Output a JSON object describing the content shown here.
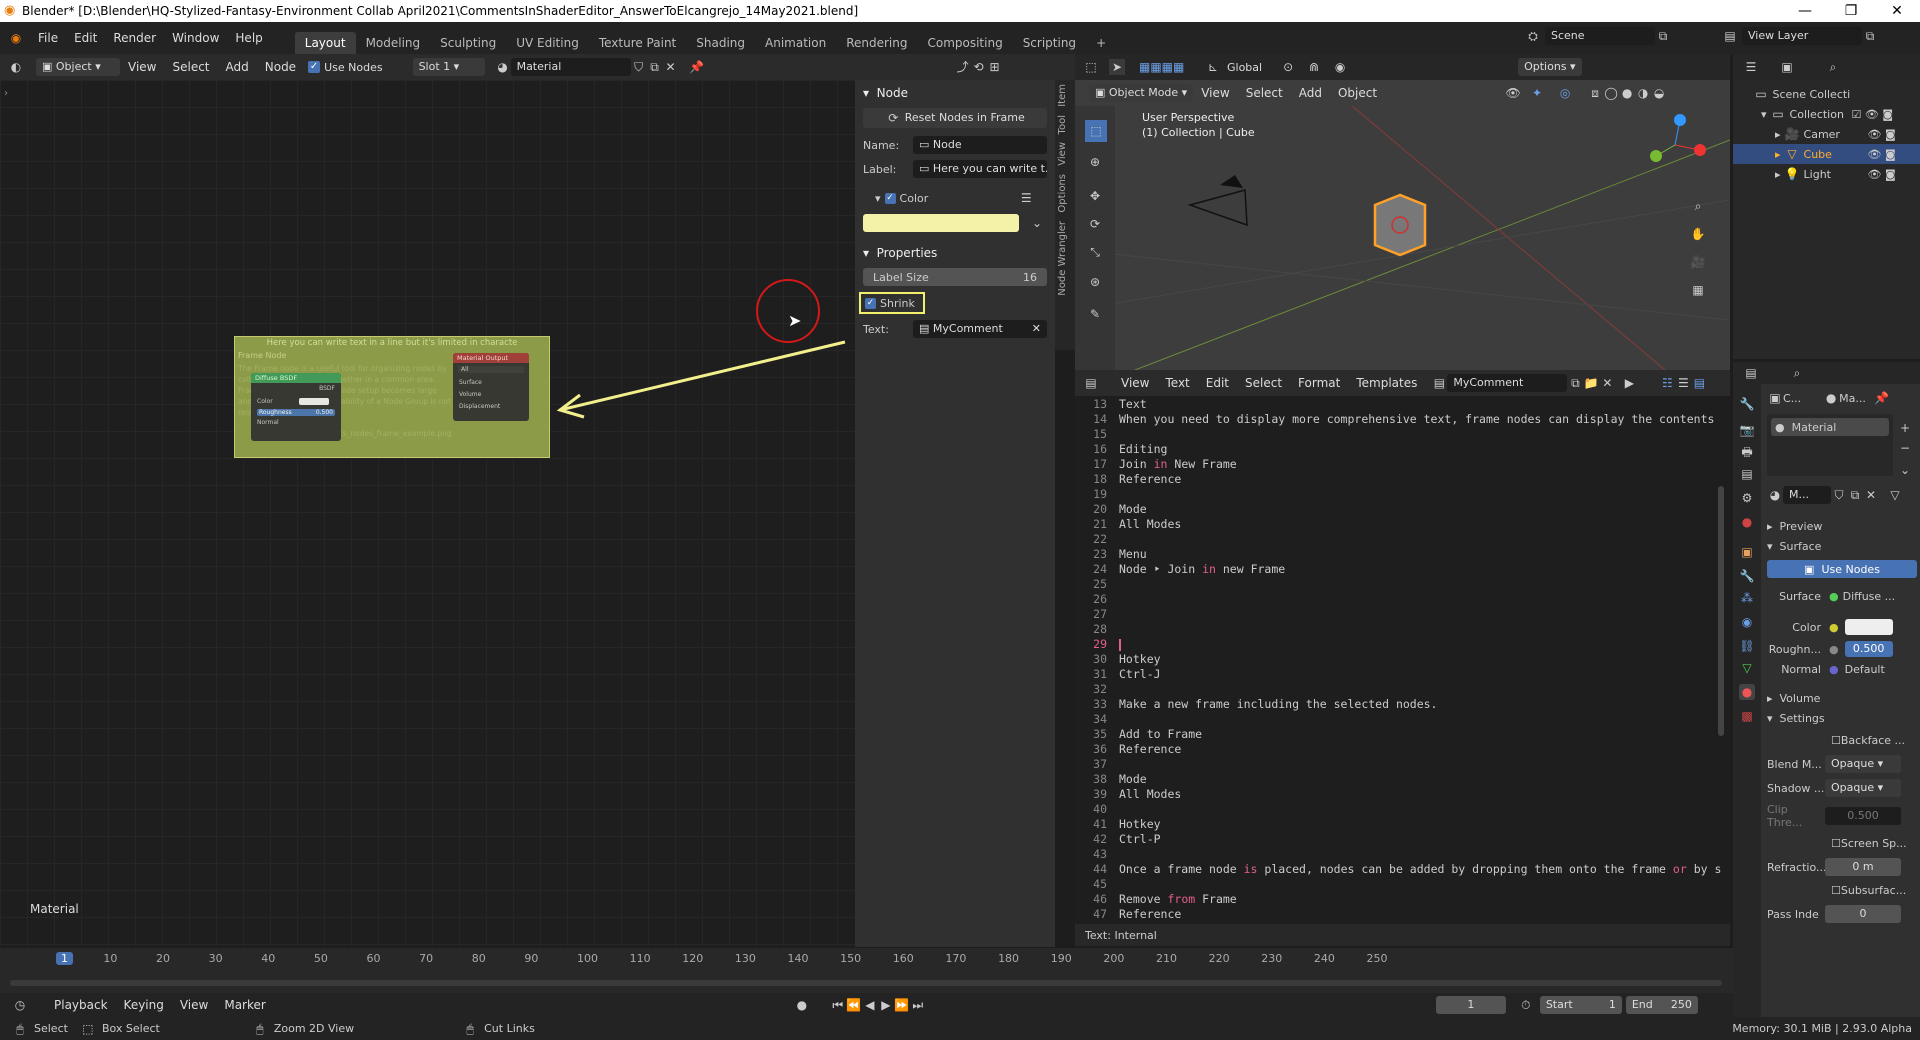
{
  "title": "Blender* [D:\\Blender\\HQ-Stylized-Fantasy-Environment  Collab April2021\\CommentsInShaderEditor_AnswerToElcangrejo_14May2021.blend]",
  "menus": [
    "File",
    "Edit",
    "Render",
    "Window",
    "Help"
  ],
  "workspaces": [
    "Layout",
    "Modeling",
    "Sculpting",
    "UV Editing",
    "Texture Paint",
    "Shading",
    "Animation",
    "Rendering",
    "Compositing",
    "Scripting"
  ],
  "scene_label": "Scene",
  "view_layer_label": "View Layer",
  "node_header": {
    "object": "Object",
    "menus": [
      "View",
      "Select",
      "Add",
      "Node"
    ],
    "use_nodes": "Use Nodes",
    "slot": "Slot 1",
    "material": "Material"
  },
  "node_editor": {
    "material_label": "Material",
    "frame": {
      "label": "Here you can write text in a line but it's limited in characte",
      "title": "Frame Node",
      "body": "The Frame node is a useful tool for organizing nodes by collecting related nodes together in a common area. Frames are useful when a node setup becomes large and confusing yet the re-usability of a Node Group is not required.",
      "footer": "nts_nodes_frame_example.png",
      "diffuse": "Diffuse BSDF",
      "bsdf": "BSDF",
      "color": "Color",
      "roughness": "Roughness",
      "roughness_val": "0.500",
      "normal": "Normal",
      "output": "Material Output",
      "output_target": "All",
      "surface": "Surface",
      "volume": "Volume",
      "displacement": "Displacement"
    }
  },
  "npanel": {
    "node_section": "Node",
    "reset_btn": "Reset Nodes in Frame",
    "name_label": "Name:",
    "name_value": "Node",
    "label_label": "Label:",
    "label_value": "Here you can write t...",
    "color_section": "Color",
    "color_hex": "#f4f1a8",
    "properties_section": "Properties",
    "label_size_label": "Label Size",
    "label_size_value": "16",
    "shrink": "Shrink",
    "text_label": "Text:",
    "text_value": "MyComment",
    "tabs": [
      "Item",
      "Tool",
      "View",
      "Options",
      "Node Wrangler"
    ]
  },
  "viewport": {
    "mode": "Object Mode",
    "menus": [
      "View",
      "Select",
      "Add",
      "Object"
    ],
    "orientation": "Global",
    "options": "Options",
    "perspective": "User Perspective",
    "collection": "(1) Collection | Cube"
  },
  "text_editor": {
    "menus": [
      "View",
      "Text",
      "Edit",
      "Select",
      "Format",
      "Templates"
    ],
    "datablock": "MyComment",
    "footer": "Text: Internal",
    "lines": [
      {
        "n": "13",
        "t": "Text"
      },
      {
        "n": "14",
        "t": "When you need to display more comprehensive text, frame nodes can display the contents"
      },
      {
        "n": "15",
        "t": ""
      },
      {
        "n": "16",
        "t": "Editing"
      },
      {
        "n": "17",
        "t": "Join in New Frame"
      },
      {
        "n": "18",
        "t": "Reference"
      },
      {
        "n": "19",
        "t": ""
      },
      {
        "n": "20",
        "t": "Mode"
      },
      {
        "n": "21",
        "t": "All Modes"
      },
      {
        "n": "22",
        "t": ""
      },
      {
        "n": "23",
        "t": "Menu"
      },
      {
        "n": "24",
        "t": "Node ‣ Join in new Frame"
      },
      {
        "n": "25",
        "t": ""
      },
      {
        "n": "26",
        "t": ""
      },
      {
        "n": "27",
        "t": ""
      },
      {
        "n": "28",
        "t": ""
      },
      {
        "n": "29",
        "t": ""
      },
      {
        "n": "30",
        "t": "Hotkey"
      },
      {
        "n": "31",
        "t": "Ctrl-J"
      },
      {
        "n": "32",
        "t": ""
      },
      {
        "n": "33",
        "t": "Make a new frame including the selected nodes."
      },
      {
        "n": "34",
        "t": ""
      },
      {
        "n": "35",
        "t": "Add to Frame"
      },
      {
        "n": "36",
        "t": "Reference"
      },
      {
        "n": "37",
        "t": ""
      },
      {
        "n": "38",
        "t": "Mode"
      },
      {
        "n": "39",
        "t": "All Modes"
      },
      {
        "n": "40",
        "t": ""
      },
      {
        "n": "41",
        "t": "Hotkey"
      },
      {
        "n": "42",
        "t": "Ctrl-P"
      },
      {
        "n": "43",
        "t": ""
      },
      {
        "n": "44",
        "t": "Once a frame node is placed, nodes can be added by dropping them onto the frame or by s"
      },
      {
        "n": "45",
        "t": ""
      },
      {
        "n": "46",
        "t": "Remove from Frame"
      },
      {
        "n": "47",
        "t": "Reference"
      }
    ]
  },
  "outliner": {
    "scene_collection": "Scene Collecti",
    "items": [
      "Collection",
      "Camer",
      "Cube",
      "Light"
    ]
  },
  "properties": {
    "tab_c": "C...",
    "tab_ma": "Ma...",
    "material_slot": "Material",
    "mat_short": "M...",
    "preview": "Preview",
    "surface_section": "Surface",
    "use_nodes": "Use Nodes",
    "surface_label": "Surface",
    "surface_value": "Diffuse ...",
    "color_label": "Color",
    "roughness_label": "Roughn...",
    "roughness_value": "0.500",
    "normal_label": "Normal",
    "normal_value": "Default",
    "volume": "Volume",
    "settings": "Settings",
    "backface": "Backface ...",
    "blend_label": "Blend M...",
    "blend_value": "Opaque",
    "shadow_label": "Shadow ...",
    "shadow_value": "Opaque",
    "clip_label": "Clip Thre...",
    "clip_value": "0.500",
    "screen_sp": "Screen Sp...",
    "refraction_label": "Refractio...",
    "refraction_value": "0 m",
    "subsurface": "Subsurfac...",
    "pass_label": "Pass Inde",
    "pass_value": "0"
  },
  "timeline": {
    "ticks": [
      "1",
      "10",
      "20",
      "30",
      "40",
      "50",
      "60",
      "70",
      "80",
      "90",
      "100",
      "110",
      "120",
      "130",
      "140",
      "150",
      "160",
      "170",
      "180",
      "190",
      "200",
      "210",
      "220",
      "230",
      "240",
      "250"
    ],
    "menus": [
      "Playback",
      "Keying",
      "View",
      "Marker"
    ],
    "current_frame": "1",
    "start_label": "Start",
    "start_value": "1",
    "end_label": "End",
    "end_value": "250"
  },
  "status": {
    "select": "Select",
    "box_select": "Box Select",
    "zoom": "Zoom 2D View",
    "cut_links": "Cut Links",
    "memory": "Memory: 30.1 MiB | 2.93.0 Alpha"
  }
}
